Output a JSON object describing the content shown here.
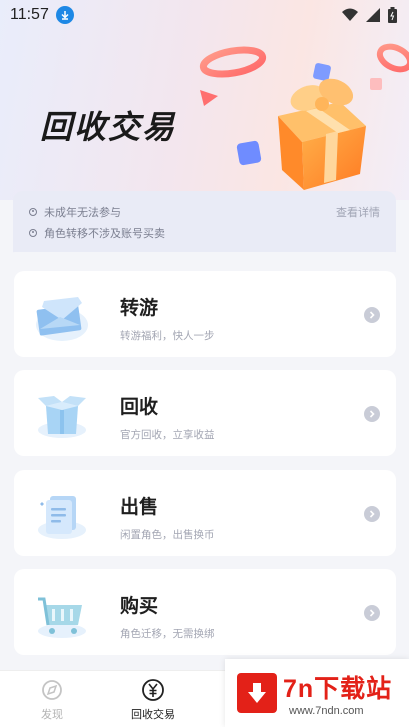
{
  "status_bar": {
    "time": "11:57"
  },
  "hero": {
    "title": "回收交易"
  },
  "notice": {
    "items": [
      "未成年无法参与",
      "角色转移不涉及账号买卖"
    ],
    "link": "查看详情"
  },
  "cards": [
    {
      "title": "转游",
      "subtitle": "转游福利，快人一步"
    },
    {
      "title": "回收",
      "subtitle": "官方回收，立享收益"
    },
    {
      "title": "出售",
      "subtitle": "闲置角色，出售换币"
    },
    {
      "title": "购买",
      "subtitle": "角色迁移，无需换绑"
    }
  ],
  "tab_bar": {
    "tabs": [
      {
        "label": "发现",
        "icon": "discover-icon"
      },
      {
        "label": "回收交易",
        "icon": "yuan-icon"
      }
    ],
    "active_color": "#222222",
    "inactive_color": "#b4b4b4"
  },
  "watermark": {
    "title": "7n下载站",
    "url": "www.7ndn.com"
  },
  "colors": {
    "accent_orange": "#ff8a2a",
    "watermark_red": "#e32118"
  }
}
